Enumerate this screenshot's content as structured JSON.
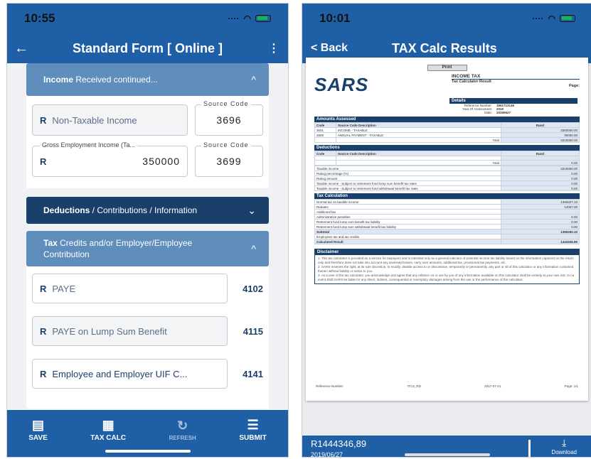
{
  "left_phone": {
    "status": {
      "time": "10:55"
    },
    "navbar": {
      "back": "←",
      "title": "Standard Form [ Online ]",
      "menu": "⋮"
    },
    "income_section": {
      "title_bold": "Income",
      "title_rest": " Received continued...",
      "chevron": "^"
    },
    "non_taxable": {
      "currency": "R",
      "placeholder": "Non-Taxable Income",
      "code_legend": "Source Code",
      "code": "3696"
    },
    "gross_employment": {
      "legend": "Gross Employment Income (Ta...",
      "currency": "R",
      "value": "350000",
      "code_legend": "Source Code",
      "code": "3699"
    },
    "deductions_section": {
      "title_bold": "Deductions",
      "title_rest": " / Contributions / Information",
      "chevron": "⌄"
    },
    "tax_section": {
      "title_bold": "Tax",
      "title_rest": " Credits and/or Employer/Employee Contribution",
      "chevron": "^"
    },
    "tax_items": [
      {
        "currency": "R",
        "label": "PAYE",
        "code": "4102"
      },
      {
        "currency": "R",
        "label": "PAYE on Lump Sum Benefit",
        "code": "4115"
      },
      {
        "currency": "R",
        "label": "Employee and Employer UIF C...",
        "code": "4141"
      }
    ],
    "bottom_bar": {
      "save": "SAVE",
      "tax_calc": "TAX CALC",
      "refresh": "REFRESH",
      "submit": "SUBMIT"
    }
  },
  "right_phone": {
    "status": {
      "time": "10:01"
    },
    "navbar": {
      "back": "< Back",
      "title": "TAX Calc Results"
    },
    "document": {
      "print_label": "Print",
      "logo": "SARS",
      "heading": "INCOME TAX",
      "subheading": "Tax Calculator Result",
      "page_label": "Page:",
      "details_title": "Details",
      "details": [
        {
          "label": "Reference Number:",
          "value": "1561713146"
        },
        {
          "label": "Year Of Assessment:",
          "value": "2019"
        },
        {
          "label": "Date:",
          "value": "20190627"
        }
      ],
      "amounts_title": "Amounts Assessed",
      "amounts_header": {
        "code": "Code",
        "desc": "Source Code Description",
        "rand": "Rand"
      },
      "amounts_rows": [
        {
          "code": "3601",
          "desc": "INCOME - TAXABLE",
          "rand": "3380000.00"
        },
        {
          "code": "3605",
          "desc": "ANNUAL PAYMENT - TAXABLE",
          "rand": "35000.00"
        }
      ],
      "amounts_total": {
        "label": "Total",
        "value": "3315000.00"
      },
      "deductions_title": "Deductions",
      "deductions_header": {
        "code": "Code",
        "desc": "Source Code Description",
        "rand": "Rand"
      },
      "deductions_total": {
        "label": "Total",
        "value": "0.00"
      },
      "summary_rows": [
        {
          "label": "Taxable income",
          "value": "3315000.00"
        },
        {
          "label": "Rating percentage (%)",
          "value": "0.00"
        },
        {
          "label": "Rating amount",
          "value": "0.00"
        },
        {
          "label": "Taxable income - Subject to retirement fund lump sum benefit tax rates",
          "value": "0.00"
        },
        {
          "label": "Taxable income - Subject to retirement fund withdrawal benefit tax rates",
          "value": "0.00"
        }
      ],
      "calc_title": "Tax Calculation",
      "calc_rows": [
        {
          "label": "Normal tax on taxable income",
          "value": "1369327.10"
        },
        {
          "label": "Rebates",
          "value": "14067.00"
        },
        {
          "label": "Additional tax",
          "value": ""
        },
        {
          "label": "Administrative penalties",
          "value": "0.00"
        },
        {
          "label": "Retirement fund lump sum benefit tax liability",
          "value": "0.00"
        },
        {
          "label": "Retirement fund lump sum withdrawal benefit tax liability",
          "value": "0.00"
        }
      ],
      "subtotal": {
        "label": "Subtotal",
        "value": "1355260.10"
      },
      "employees_credits": {
        "label": "Employees tax and tax credits",
        "value": ""
      },
      "calculated_result": {
        "label": "Calculated Result",
        "value": "1444346.89"
      },
      "disclaimer_title": "Disclaimer",
      "disclaimer_items": [
        "1. This tax calculator is provided as a service for taxpayers and is intended only as a general indicator of potential income tax liability based on the information captured on the return only and therefore does not take into account any assessed losses, carry over amounts, additional tax, provisional tax payments, etc.",
        "2. SARS reserves the right, at its sole discretion, to modify, disable access to or discontinue, temporarily or permanently, any part or all of this calculator or any information contained therein without liability or notice to you.",
        "3. As a user of the tax calculator, you acknowledge and agree that any reliance on or use by you of any information available on this calculator shall be entirely at your own risk. In no event shall SARS be liable for any direct, indirect, consequential or exemplary damages arising from the use or the performance of the calculator."
      ],
      "footer": {
        "ref_label": "Reference Number:",
        "form": "ITCS_RD",
        "date": "2017-07-21",
        "page": "Page: 1/1"
      }
    },
    "footer": {
      "amount": "R1444346,89",
      "date": "2019/06/27",
      "download": "Download"
    }
  }
}
